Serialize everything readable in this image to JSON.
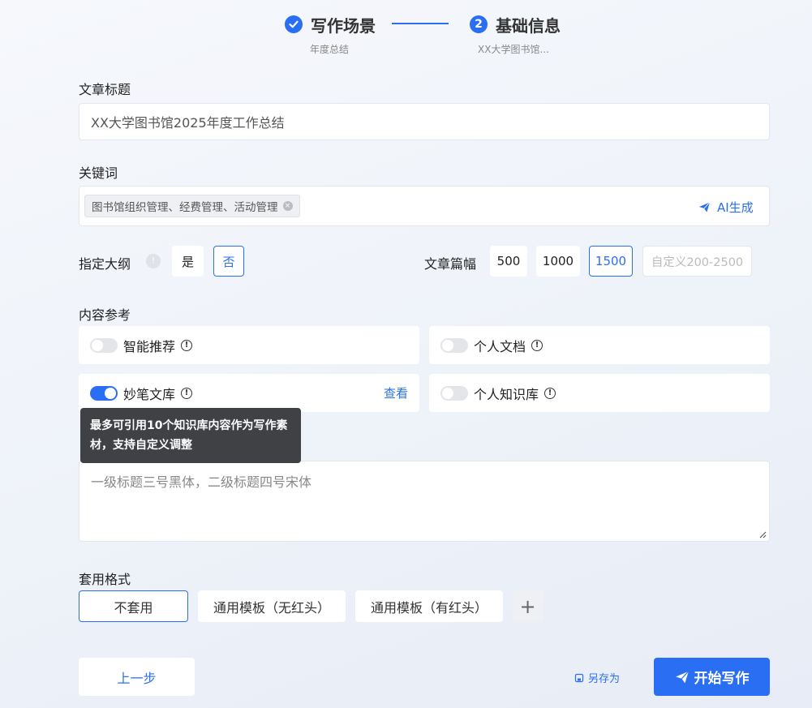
{
  "steps": [
    {
      "title": "写作场景",
      "sub": "年度总结"
    },
    {
      "number": "2",
      "title": "基础信息",
      "sub": "XX大学图书馆..."
    }
  ],
  "title_field": {
    "label": "文章标题",
    "value": "XX大学图书馆2025年度工作总结"
  },
  "keywords": {
    "label": "关键词",
    "chip": "图书馆组织管理、经费管理、活动管理",
    "ai_button": "AI生成"
  },
  "outline": {
    "label": "指定大纲",
    "yes": "是",
    "no": "否",
    "selected": "否"
  },
  "length": {
    "label": "文章篇幅",
    "options": [
      "500",
      "1000",
      "1500"
    ],
    "selected": "1500",
    "custom_placeholder": "自定义200-2500"
  },
  "references": {
    "label": "内容参考",
    "items": [
      {
        "label": "智能推荐",
        "on": false
      },
      {
        "label": "个人文档",
        "on": false
      },
      {
        "label": "妙笔文库",
        "on": true,
        "action": "查看"
      },
      {
        "label": "个人知识库",
        "on": false
      }
    ],
    "tooltip": "最多可引用10个知识库内容作为写作素材，支持自定义调整"
  },
  "requirements": {
    "placeholder": "一级标题三号黑体，二级标题四号宋体"
  },
  "format": {
    "label": "套用格式",
    "options": [
      "不套用",
      "通用模板（无红头）",
      "通用模板（有红头）"
    ],
    "selected": "不套用",
    "add": "+"
  },
  "footer": {
    "prev": "上一步",
    "save_as": "另存为",
    "start": "开始写作"
  },
  "colors": {
    "accent": "#2a6ff3",
    "tooltip_bg": "#3f4145"
  }
}
